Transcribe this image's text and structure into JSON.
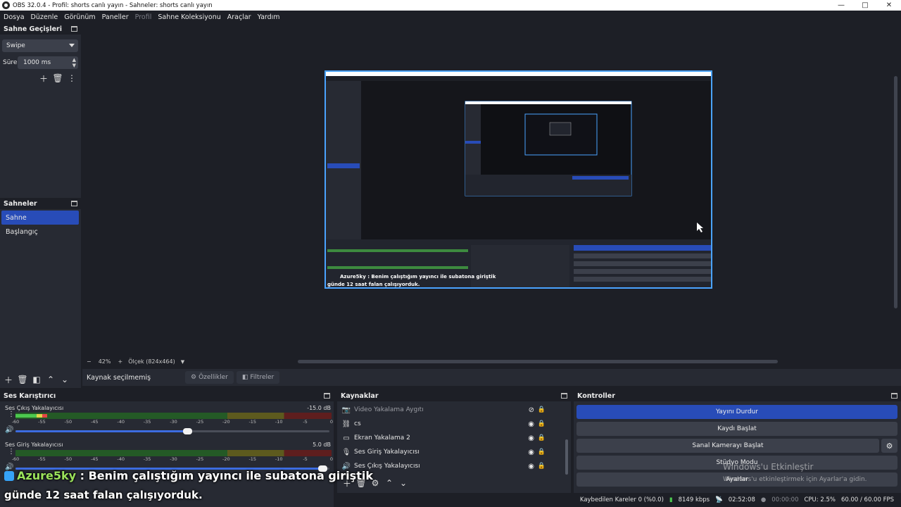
{
  "window": {
    "title": "OBS 32.0.4 - Profil: shorts canlı yayın - Sahneler: shorts canlı yayın",
    "controls": [
      "—",
      "□",
      "✕"
    ]
  },
  "menu": [
    "Dosya",
    "Düzenle",
    "Görünüm",
    "Paneller",
    "Profil",
    "Sahne Koleksiyonu",
    "Araçlar",
    "Yardım"
  ],
  "transitions": {
    "title": "Sahne Geçişleri",
    "selected": "Swipe",
    "duration_label": "Süre",
    "duration": "1000 ms"
  },
  "scenes": {
    "title": "Sahneler",
    "items": [
      "Sahne",
      "Başlangıç"
    ],
    "active": "Sahne"
  },
  "preview": {
    "zoom": "42%",
    "scale_label": "Ölçek (824x464)"
  },
  "source_bar": {
    "no_source": "Kaynak seçilmemiş",
    "properties": "Özellikler",
    "filters": "Filtreler"
  },
  "mixer": {
    "title": "Ses Karıştırıcı",
    "scale": [
      "-60",
      "-55",
      "-50",
      "-45",
      "-40",
      "-35",
      "-30",
      "-25",
      "-20",
      "-15",
      "-10",
      "-5",
      "0"
    ],
    "channels": [
      {
        "name": "Ses Çıkış Yakalayıcısı",
        "db": "-15.0 dB",
        "level": 0.1,
        "volume": 0.55
      },
      {
        "name": "Ses Giriş Yakalayıcısı",
        "db": "5.0 dB",
        "level": 0.0,
        "volume": 0.98
      }
    ]
  },
  "sources": {
    "title": "Kaynaklar",
    "items": [
      {
        "name": "Video Yakalama Aygıtı",
        "icon": "camera-icon",
        "visible": false
      },
      {
        "name": "cs",
        "icon": "link-icon",
        "visible": true
      },
      {
        "name": "Ekran Yakalama 2",
        "icon": "monitor-icon",
        "visible": true
      },
      {
        "name": "Ses Giriş Yakalayıcısı",
        "icon": "microphone-icon",
        "visible": true
      },
      {
        "name": "Ses Çıkış Yakalayıcısı",
        "icon": "speaker-icon",
        "visible": true
      }
    ]
  },
  "controls": {
    "title": "Kontroller",
    "stop_stream": "Yayını Durdur",
    "start_record": "Kaydı Başlat",
    "start_virtualcam": "Sanal Kamerayı Başlat",
    "studio_mode": "Stüdyo Modu",
    "settings": "Ayarlar"
  },
  "status": {
    "dropped_frames": "Kaybedilen Kareler 0 (%0.0)",
    "bitrate": "8149 kbps",
    "stream_time": "02:52:08",
    "record_time": "00:00:00",
    "cpu": "CPU: 2.5%",
    "fps": "60.00 / 60.00 FPS"
  },
  "activation": {
    "line1": "Windows'u Etkinleştir",
    "line2": "Windows'u etkinleştirmek için Ayarlar'a gidin."
  },
  "chat_overlay": {
    "user": "Azure5ky",
    "message_line1": " : Benim çalıştığım yayıncı ile subatona giriştik",
    "message_line2": "günde 12 saat falan çalışıyorduk."
  },
  "colors": {
    "accent": "#284cb8",
    "preview_border": "#4aa3ff",
    "panel": "#272a33",
    "background": "#1d1f26",
    "chat_user": "#9be35b"
  }
}
